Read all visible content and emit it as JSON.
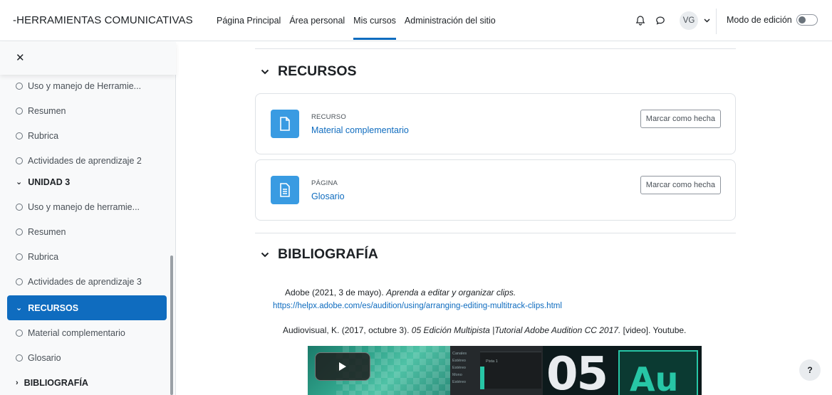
{
  "navbar": {
    "brand": "-HERRAMIENTAS COMUNICATIVAS",
    "links": [
      "Página Principal",
      "Área personal",
      "Mis cursos",
      "Administración del sitio"
    ],
    "active_link": "Mis cursos",
    "notifications_icon": "bell-icon",
    "messages_icon": "chat-bubble-icon",
    "user_initials": "VG",
    "edit_mode_label": "Modo de edición",
    "edit_mode_on": false
  },
  "drawer": {
    "close_icon": "close-icon",
    "items": [
      {
        "label": "Uso y manejo de Herramie...",
        "type": "activity"
      },
      {
        "label": "Resumen",
        "type": "activity"
      },
      {
        "label": "Rubrica",
        "type": "activity"
      },
      {
        "label": "Actividades de aprendizaje 2",
        "type": "activity"
      },
      {
        "label": "UNIDAD 3",
        "type": "section",
        "expanded": true
      },
      {
        "label": "Uso y manejo de herramie...",
        "type": "activity"
      },
      {
        "label": "Resumen",
        "type": "activity"
      },
      {
        "label": "Rubrica",
        "type": "activity"
      },
      {
        "label": "Actividades de aprendizaje 3",
        "type": "activity"
      },
      {
        "label": "RECURSOS",
        "type": "section",
        "expanded": true,
        "active": true
      },
      {
        "label": "Material complementario",
        "type": "activity"
      },
      {
        "label": "Glosario",
        "type": "activity"
      },
      {
        "label": "BIBLIOGRAFÍA",
        "type": "section",
        "expanded": false
      }
    ]
  },
  "sections": {
    "recursos": {
      "title": "RECURSOS",
      "activities": [
        {
          "type": "RECURSO",
          "name": "Material complementario",
          "icon": "file-icon",
          "button": "Marcar como hecha"
        },
        {
          "type": "PÁGINA",
          "name": "Glosario",
          "icon": "page-icon",
          "button": "Marcar como hecha"
        }
      ]
    },
    "bibliografia": {
      "title": "BIBLIOGRAFÍA",
      "ref1_text": "Adobe (2021, 3 de mayo). ",
      "ref1_italic": "Aprenda a editar y organizar clips.",
      "ref1_link": "https://helpx.adobe.com/es/audition/using/arranging-editing-multitrack-clips.html",
      "ref2_text": "Audiovisual, K. (2017, octubre 3). ",
      "ref2_italic": "05 Edición Multipista |Tutorial Adobe Audition CC 2017.",
      "ref2_tail": " [video].  Youtube.",
      "video": {
        "channels": [
          "Canales",
          "Estéreo",
          "Estéreo",
          "Mono",
          "Estéreo"
        ],
        "track_label": "Pista 1",
        "number": "05",
        "logo": "Au",
        "play_icon": "play-icon"
      }
    }
  },
  "help_label": "?"
}
